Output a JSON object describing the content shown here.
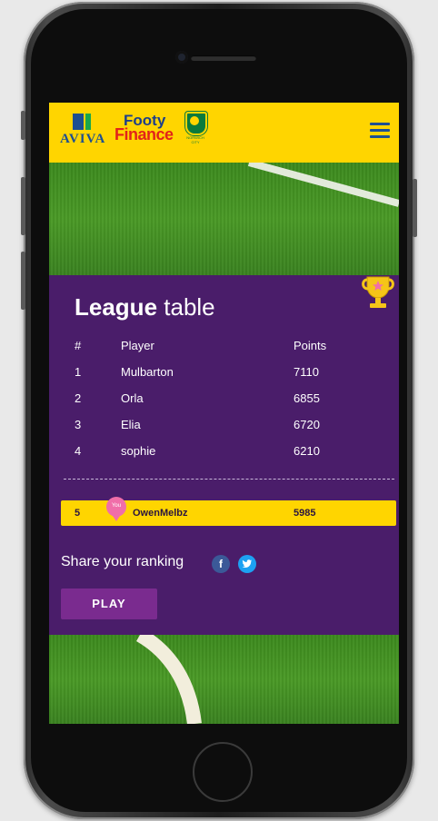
{
  "header": {
    "aviva_logo_text": "AVIVA",
    "footy_line1": "Footy",
    "footy_line2": "Finance",
    "ncfc_text": "NORWICH CITY"
  },
  "league": {
    "title_bold": "League",
    "title_rest": "table",
    "columns": {
      "rank": "#",
      "player": "Player",
      "points": "Points"
    },
    "rows": [
      {
        "rank": "1",
        "player": "Mulbarton",
        "points": "7110"
      },
      {
        "rank": "2",
        "player": "Orla",
        "points": "6855"
      },
      {
        "rank": "3",
        "player": "Elia",
        "points": "6720"
      },
      {
        "rank": "4",
        "player": "sophie",
        "points": "6210"
      }
    ],
    "you": {
      "badge": "You",
      "rank": "5",
      "player": "OwenMelbz",
      "points": "5985"
    }
  },
  "share": {
    "label": "Share your ranking",
    "facebook_icon": "f",
    "twitter_icon": "t"
  },
  "play_button": "PLAY",
  "colors": {
    "header_yellow": "#ffd500",
    "panel_purple": "#4a1d6a",
    "play_button": "#7a2b8f",
    "you_badge": "#f06ea9"
  }
}
